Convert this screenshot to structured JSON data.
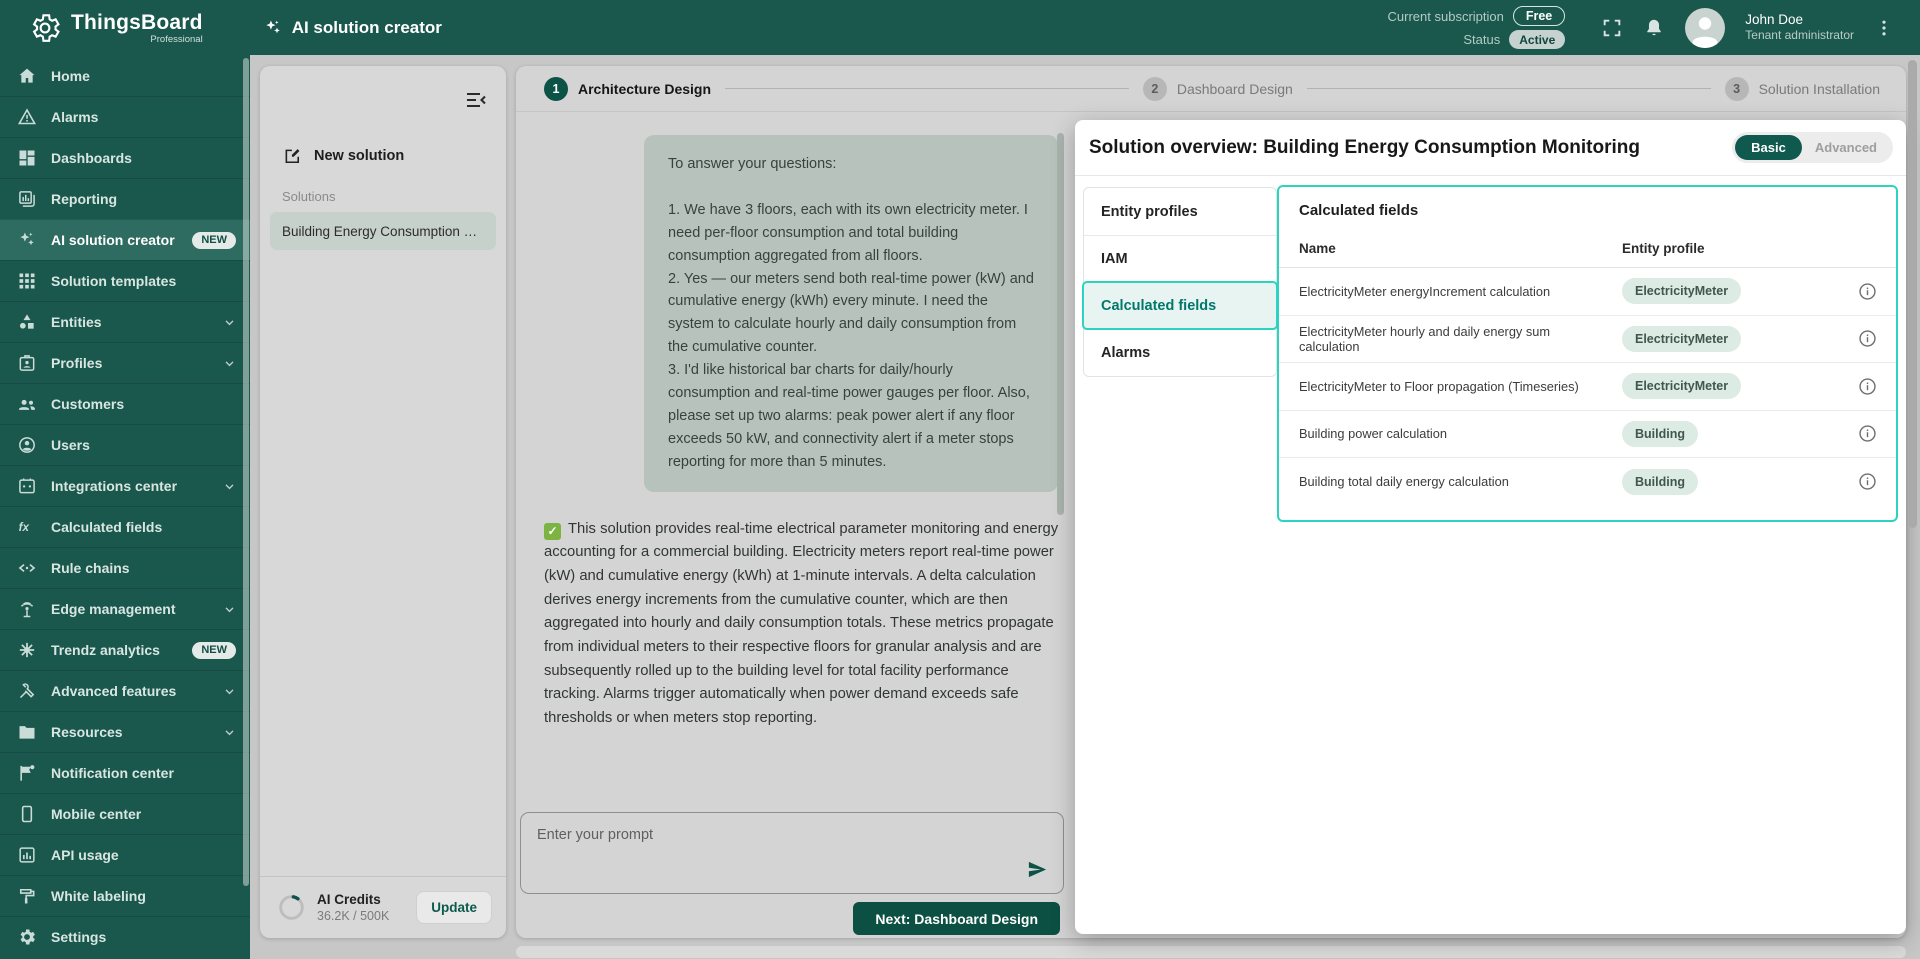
{
  "header": {
    "brand": "ThingsBoard",
    "brand_sub": "Professional",
    "app_title": "AI solution creator",
    "subscription_label": "Current subscription",
    "subscription_value": "Free",
    "status_label": "Status",
    "status_value": "Active",
    "user_name": "John Doe",
    "user_role": "Tenant administrator"
  },
  "sidebar": {
    "items": [
      {
        "label": "Home"
      },
      {
        "label": "Alarms"
      },
      {
        "label": "Dashboards"
      },
      {
        "label": "Reporting"
      },
      {
        "label": "AI solution creator",
        "badge": "NEW"
      },
      {
        "label": "Solution templates"
      },
      {
        "label": "Entities"
      },
      {
        "label": "Profiles"
      },
      {
        "label": "Customers"
      },
      {
        "label": "Users"
      },
      {
        "label": "Integrations center"
      },
      {
        "label": "Calculated fields"
      },
      {
        "label": "Rule chains"
      },
      {
        "label": "Edge management"
      },
      {
        "label": "Trendz analytics",
        "badge": "NEW"
      },
      {
        "label": "Advanced features"
      },
      {
        "label": "Resources"
      },
      {
        "label": "Notification center"
      },
      {
        "label": "Mobile center"
      },
      {
        "label": "API usage"
      },
      {
        "label": "White labeling"
      },
      {
        "label": "Settings"
      }
    ]
  },
  "solutions_panel": {
    "new_solution_label": "New solution",
    "section_label": "Solutions",
    "items": [
      {
        "name": "Building Energy Consumption …"
      }
    ],
    "credits": {
      "title": "AI Credits",
      "usage": "36.2K / 500K",
      "update_label": "Update"
    }
  },
  "stepper": {
    "steps": [
      {
        "num": "1",
        "label": "Architecture Design"
      },
      {
        "num": "2",
        "label": "Dashboard Design"
      },
      {
        "num": "3",
        "label": "Solution Installation"
      }
    ]
  },
  "chat": {
    "user_message": "To answer your questions:\n\n1. We have 3 floors, each with its own electricity meter. I need per-floor consumption and total building consumption aggregated from all floors.\n2. Yes — our meters send both real-time power (kW) and cumulative energy (kWh) every minute. I need the system to calculate hourly and daily consumption from the cumulative counter.\n3. I'd like historical bar charts for daily/hourly consumption and real-time power gauges per floor. Also, please set up two alarms: peak power alert if any floor exceeds 50 kW, and connectivity alert if a meter stops\nreporting for more than 5 minutes.",
    "assistant_check": "✓",
    "assistant_message": "This solution provides real-time electrical parameter monitoring and energy accounting for a commercial building. Electricity meters report real-time power (kW) and cumulative energy (kWh) at 1-minute intervals. A delta calculation derives energy increments from the cumulative counter, which are then aggregated into hourly and daily consumption totals. These metrics propagate from individual meters to their respective floors for granular analysis and are subsequently rolled up to the building level for total facility performance tracking. Alarms trigger automatically when power demand exceeds safe thresholds or when meters stop reporting.",
    "input_placeholder": "Enter your prompt",
    "next_button_label": "Next: Dashboard Design"
  },
  "overview": {
    "title": "Solution overview: Building Energy Consumption Monitoring",
    "mode_toggle": {
      "basic": "Basic",
      "advanced": "Advanced"
    },
    "tabs": [
      {
        "label": "Entity profiles"
      },
      {
        "label": "IAM"
      },
      {
        "label": "Calculated fields"
      },
      {
        "label": "Alarms"
      }
    ],
    "table": {
      "title": "Calculated fields",
      "columns": [
        "Name",
        "Entity profile"
      ],
      "rows": [
        {
          "name": "ElectricityMeter energyIncrement calculation",
          "entity_profile": "ElectricityMeter"
        },
        {
          "name": "ElectricityMeter hourly and daily energy sum calculation",
          "entity_profile": "ElectricityMeter"
        },
        {
          "name": "ElectricityMeter to Floor propagation (Timeseries)",
          "entity_profile": "ElectricityMeter"
        },
        {
          "name": "Building power calculation",
          "entity_profile": "Building"
        },
        {
          "name": "Building total daily energy calculation",
          "entity_profile": "Building"
        }
      ]
    }
  },
  "colors": {
    "brand_teal": "#1a574d",
    "accent_dark_teal": "#0d5247",
    "highlight_turquoise": "#2bd3c0",
    "selected_tab_text": "#00786c",
    "chip_bg": "#dcebe4"
  }
}
